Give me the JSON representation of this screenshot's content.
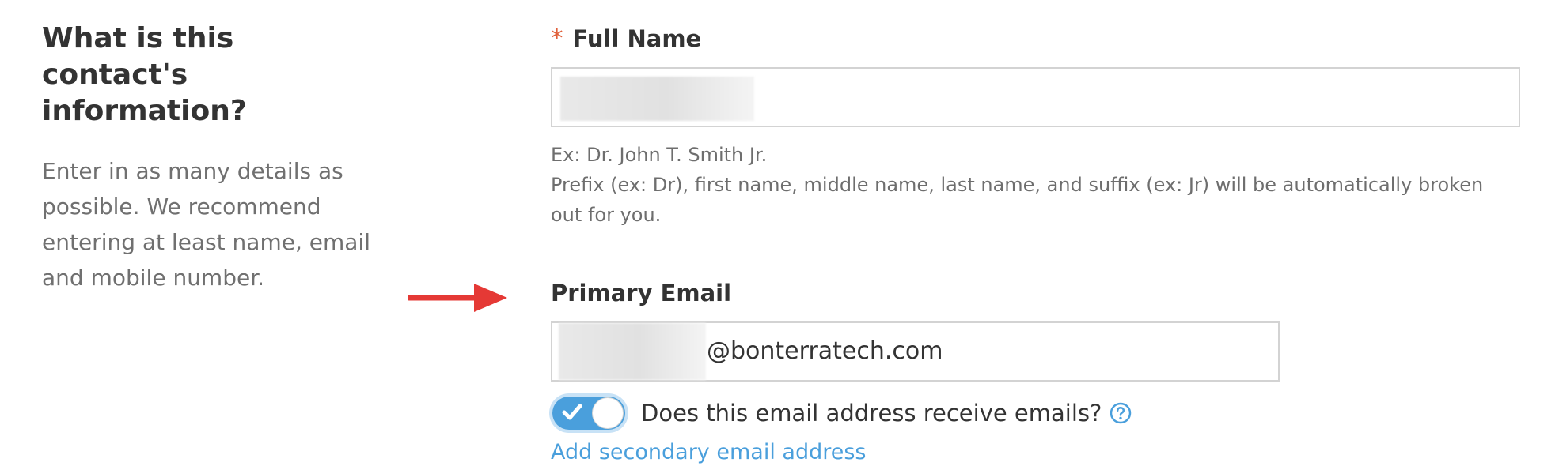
{
  "intro": {
    "title": "What is this contact's information?",
    "description": "Enter in as many details as possible. We recommend entering at least name, email and mobile number."
  },
  "full_name": {
    "required_marker": "*",
    "label": "Full Name",
    "value": "",
    "hint_example": "Ex: Dr. John T. Smith Jr.",
    "hint_detail": "Prefix (ex: Dr), first name, middle name, last name, and suffix (ex: Jr) will be automatically broken out for you."
  },
  "primary_email": {
    "label": "Primary Email",
    "value_suffix": "@bonterratech.com",
    "toggle_label": "Does this email address receive emails?",
    "toggle_on": true,
    "help_icon": "question-circle-icon",
    "secondary_link": "Add secondary email address"
  },
  "annotation": {
    "arrow_icon": "red-arrow-right-icon",
    "arrow_color": "#e53935"
  },
  "colors": {
    "accent": "#4a9fdc",
    "required": "#e0603b",
    "text": "#333333",
    "muted": "#707070"
  }
}
